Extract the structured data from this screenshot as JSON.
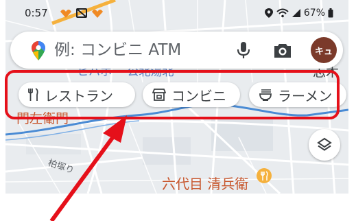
{
  "status_bar": {
    "time": "0:57",
    "battery": "67%"
  },
  "search": {
    "placeholder": "例: コンビニ ATM"
  },
  "account": {
    "avatar_text": "キュ"
  },
  "chips": [
    {
      "label": "レストラン",
      "icon": "fork-knife-icon"
    },
    {
      "label": "コンビニ",
      "icon": "store-icon"
    },
    {
      "label": "ラーメン",
      "icon": "ramen-icon"
    }
  ],
  "map_labels": {
    "top_left": "ヒハホー 公北湯北",
    "top_right": "志木",
    "temple": "門左衛門",
    "street": "柏塚り",
    "place": "六代目 清兵衛"
  },
  "colors": {
    "highlight": "#e5101a",
    "map_background": "#e9ecef",
    "water": "#4a8bd4",
    "main_road": "#f5b13d",
    "poi": "#c8582f"
  }
}
